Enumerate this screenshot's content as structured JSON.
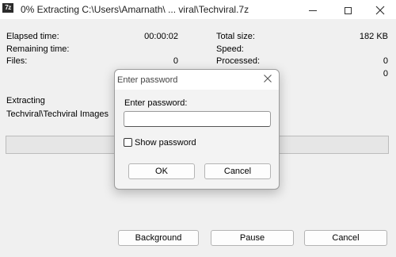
{
  "window": {
    "title": "0% Extracting C:\\Users\\Amarnath\\ ... viral\\Techviral.7z",
    "app_icon_text": "7z",
    "icon_names": [
      "minimize-icon",
      "maximize-icon",
      "close-icon"
    ]
  },
  "stats": {
    "elapsed_label": "Elapsed time:",
    "elapsed_value": "00:00:02",
    "remaining_label": "Remaining time:",
    "files_label": "Files:",
    "files_value": "0",
    "total_size_label": "Total size:",
    "total_size_value": "182 KB",
    "speed_label": "Speed:",
    "processed_label": "Processed:",
    "processed_value": "0",
    "hidden_value": "0"
  },
  "operation": {
    "label": "Extracting",
    "path": "Techviral\\Techviral Images"
  },
  "progress": {
    "percent": 0,
    "fill_color": "#06b025"
  },
  "buttons": {
    "background": "Background",
    "pause": "Pause",
    "cancel": "Cancel"
  },
  "dialog": {
    "title": "Enter password",
    "prompt": "Enter password:",
    "password_value": "",
    "show_password_label": "Show password",
    "show_password_checked": false,
    "ok": "OK",
    "cancel": "Cancel"
  }
}
